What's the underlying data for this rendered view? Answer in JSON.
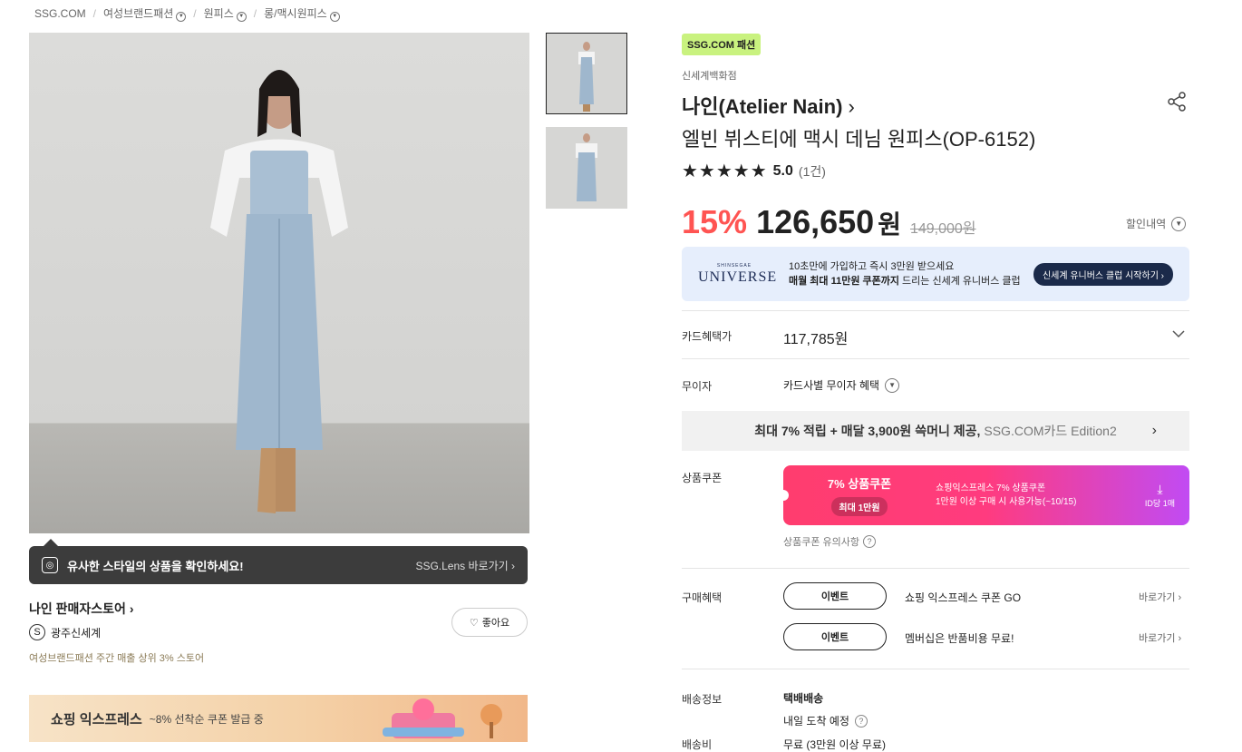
{
  "breadcrumb": [
    "SSG.COM",
    "여성브랜드패션",
    "원피스",
    "롱/맥시원피스"
  ],
  "gallery": {
    "lens_title": "유사한 스타일의 상품을 확인하세요!",
    "lens_link": "SSG.Lens 바로가기"
  },
  "store": {
    "name": "나인 판매자스토어",
    "badge_letter": "S",
    "badge_label": "광주신세계",
    "rank": "여성브랜드패션 주간 매출 상위 3% 스토어",
    "like_label": "좋아요"
  },
  "promo": {
    "title": "쇼핑 익스프레스",
    "subtitle": "~8% 선착순 쿠폰 발급 중"
  },
  "product": {
    "mall_tag": "SSG.COM 패션",
    "dept": "신세계백화점",
    "brand": "나인(Atelier Nain)",
    "name": "엘빈 뷔스티에 맥시 데님 원피스(OP-6152)",
    "stars": "★★★★★",
    "rating": 5.0,
    "rating_text": "5.0",
    "review_count": "(1건)",
    "discount": "15%",
    "price": "126,650",
    "won": "원",
    "orig_price": "149,000원",
    "discount_history": "할인내역"
  },
  "universe": {
    "brand_small": "SHINSEGAE",
    "brand": "UNIVERSE",
    "line1": "10초만에 가입하고 즉시 3만원 받으세요",
    "line2_bold": "매월 최대 11만원 쿠폰까지",
    "line2_rest": " 드리는 신세계 유니버스 클럽",
    "cta": "신세계 유니버스 클럽 시작하기 ›"
  },
  "benefits": {
    "card_label": "카드혜택가",
    "card_price": "117,785원",
    "noint_label": "무이자",
    "noint_value": "카드사별 무이자 혜택",
    "ssgcard_bold": "최대 7% 적립 + 매달 3,900원 쓱머니 제공,",
    "ssgcard_gray": "SSG.COM카드 Edition2",
    "coupon_label": "상품쿠폰",
    "coupon_title": "7% 상품쿠폰",
    "coupon_max": "최대 1만원",
    "coupon_desc1": "쇼핑익스프레스 7% 상품쿠폰",
    "coupon_desc2": "1만원 이상 구매 시 사용가능(~10/15)",
    "coupon_limit": "ID당 1매",
    "coupon_note": "상품쿠폰 유의사항",
    "purchase_label": "구매혜택",
    "events": [
      {
        "btn": "이벤트",
        "text": "쇼핑 익스프레스 쿠폰 GO",
        "link": "바로가기"
      },
      {
        "btn": "이벤트",
        "text": "멤버십은 반품비용 무료!",
        "link": "바로가기"
      }
    ]
  },
  "shipping": {
    "label": "배송정보",
    "method": "택배배송",
    "eta": "내일 도착 예정",
    "fee_label": "배송비",
    "fee": "무료 (3만원 이상 무료)"
  },
  "colors": {
    "discount": "#ff5452",
    "mall_tag": "#c9f27f",
    "universe_bg": "#e6eefc"
  }
}
